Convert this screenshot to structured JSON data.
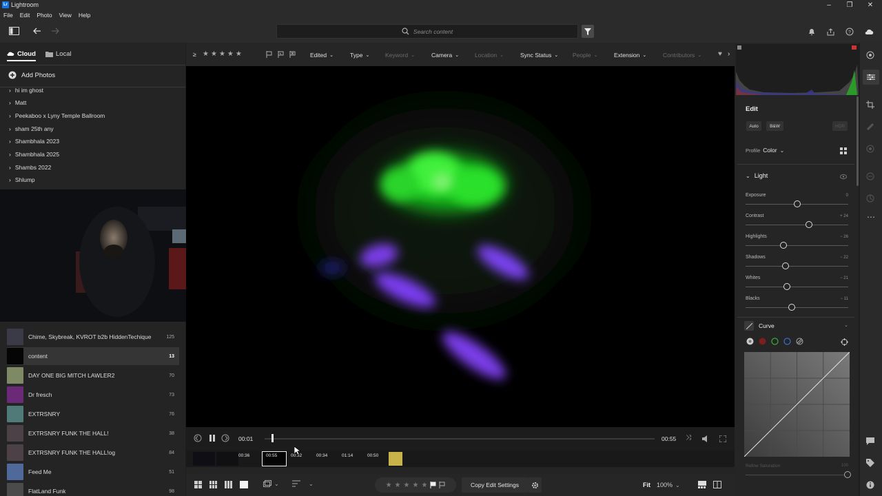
{
  "app": {
    "title": "Lightroom",
    "logo": "Lr"
  },
  "menu": [
    "File",
    "Edit",
    "Photo",
    "View",
    "Help"
  ],
  "search": {
    "placeholder": "Search content"
  },
  "left": {
    "tabs": [
      {
        "label": "Cloud",
        "active": true
      },
      {
        "label": "Local",
        "active": false
      }
    ],
    "add_photos": "Add Photos",
    "albums": [
      "hi im ghost",
      "Matt",
      "Peekaboo x Lyny Temple Ballroom",
      "sham 25th any",
      "Shambhala 2023",
      "Shambhala 2025",
      "Shambs 2022",
      "Shlump"
    ],
    "collections": [
      {
        "name": "Chime, Skybreak, KVROT b2b HiddenTechique",
        "count": "125",
        "color": "#3a3b46"
      },
      {
        "name": "content",
        "count": "13",
        "selected": true,
        "color": "#050505"
      },
      {
        "name": "DAY ONE BIG MITCH LAWLER2",
        "count": "70",
        "color": "#7e8a66"
      },
      {
        "name": "Dr fresch",
        "count": "73",
        "color": "#6a2a78"
      },
      {
        "name": "EXTRSNRY",
        "count": "76",
        "color": "#4f7a78"
      },
      {
        "name": "EXTRSNRY FUNK THE HALL!",
        "count": "38",
        "color": "#4d4148"
      },
      {
        "name": "EXTRSNRY FUNK THE HALL!og",
        "count": "84",
        "color": "#4d4148"
      },
      {
        "name": "Feed Me",
        "count": "51",
        "color": "#4f6a9a"
      },
      {
        "name": "FlatLand Funk",
        "count": "98",
        "color": "#4b4b4b"
      }
    ]
  },
  "filters": {
    "rating_op": "≥",
    "items": [
      {
        "label": "Edited",
        "enabled": true
      },
      {
        "label": "Type",
        "enabled": true
      },
      {
        "label": "Keyword",
        "enabled": false
      },
      {
        "label": "Camera",
        "enabled": true
      },
      {
        "label": "Location",
        "enabled": false
      },
      {
        "label": "Sync Status",
        "enabled": true
      },
      {
        "label": "People",
        "enabled": false
      },
      {
        "label": "Extension",
        "enabled": true
      },
      {
        "label": "Contributors",
        "enabled": false
      }
    ]
  },
  "video": {
    "current_time": "00:01",
    "duration": "00:55",
    "progress": 0.02
  },
  "filmstrip": {
    "markers": [
      "00:36",
      "00:55",
      "00:32",
      "00:34",
      "01:14",
      "00:50"
    ]
  },
  "bottom": {
    "copy_edit": "Copy Edit Settings",
    "fit": "Fit",
    "zoom": "100%"
  },
  "edit": {
    "title": "Edit",
    "auto": "Auto",
    "bw": "B&W",
    "hdr": "HDR",
    "profile_label": "Profile",
    "profile_value": "Color",
    "light_title": "Light",
    "sliders": [
      {
        "label": "Exposure",
        "value": "0",
        "pos": 0.5
      },
      {
        "label": "Contrast",
        "value": "+ 24",
        "pos": 0.62
      },
      {
        "label": "Highlights",
        "value": "− 26",
        "pos": 0.37
      },
      {
        "label": "Shadows",
        "value": "− 22",
        "pos": 0.39
      },
      {
        "label": "Whites",
        "value": "− 21",
        "pos": 0.4
      },
      {
        "label": "Blacks",
        "value": "− 11",
        "pos": 0.45
      }
    ],
    "curve_title": "Curve",
    "refine_label": "Refine Saturation",
    "refine_value": "100"
  }
}
